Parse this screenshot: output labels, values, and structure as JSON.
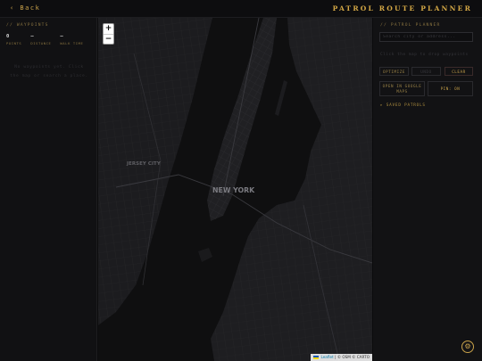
{
  "header": {
    "back_label": "‹ Back",
    "title": "PATROL ROUTE PLANNER"
  },
  "waypoints_panel": {
    "title": "// WAYPOINTS",
    "stats": [
      {
        "value": "0",
        "label": "POINTS"
      },
      {
        "value": "—",
        "label": "DISTANCE"
      },
      {
        "value": "—",
        "label": "WALK TIME"
      }
    ],
    "empty_message": "No waypoints yet. Click the map or search a place."
  },
  "map": {
    "zoom_in": "+",
    "zoom_out": "−",
    "labels": {
      "jersey_city": "JERSEY CITY",
      "new_york": "NEW YORK"
    },
    "attribution": {
      "leaflet": "Leaflet",
      "separator": " | ",
      "credit": "© OSM © CARTO"
    }
  },
  "planner_panel": {
    "title": "// PATROL PLANNER",
    "search": {
      "placeholder": "Search city or address...",
      "value": ""
    },
    "hint": "Click the map to drop waypoints",
    "buttons": {
      "optimize": "OPTIMIZE",
      "undo": "UNDO",
      "clear": "CLEAR",
      "google_maps_line1": "OPEN IN GOOGLE",
      "google_maps_line2": "MAPS",
      "pin": "PIN: ON"
    },
    "saved_toggle": "▸ SAVED PATROLS"
  },
  "settings_icon": "⚙",
  "colors": {
    "accent": "#c9a24a",
    "background": "#0b0b0c",
    "panel": "#111113",
    "map_land": "#1c1c1f",
    "map_water": "#0f0f10"
  }
}
